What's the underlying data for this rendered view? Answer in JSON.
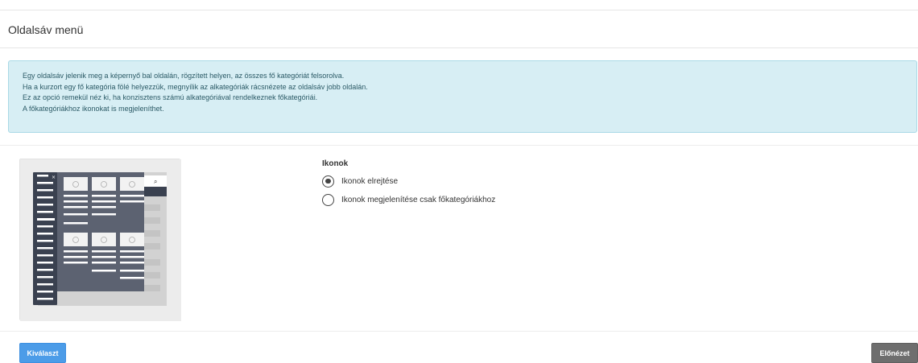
{
  "header": {
    "title": "Oldalsáv menü"
  },
  "info": {
    "lines": [
      "Egy oldalsáv jelenik meg a képernyő bal oldalán, rögzített helyen, az összes fő kategóriát felsorolva.",
      "Ha a kurzort egy fő kategória fölé helyezzük, megnyílik az alkategóriák rácsnézete az oldalsáv jobb oldalán.",
      "Ez az opció remekül néz ki, ha konzisztens számú alkategóriával rendelkeznek főkategóriái.",
      "A főkategóriákhoz ikonokat is megjeleníthet."
    ]
  },
  "options": {
    "title": "Ikonok",
    "items": [
      {
        "label": "Ikonok elrejtése",
        "selected": true
      },
      {
        "label": "Ikonok megjelenítése csak főkategóriákhoz",
        "selected": false
      }
    ]
  },
  "footer": {
    "select_label": "Kiválaszt",
    "preview_label": "Előnézet"
  },
  "preview_icons": {
    "close": "close-icon",
    "search": "search-icon",
    "image_placeholder": "image-placeholder-icon"
  },
  "colors": {
    "info_bg": "#d7eef4",
    "primary": "#4c9ce8",
    "secondary": "#6e6e6e",
    "sidebar_dark": "#3a4150",
    "panel_dark": "#5c6271"
  }
}
